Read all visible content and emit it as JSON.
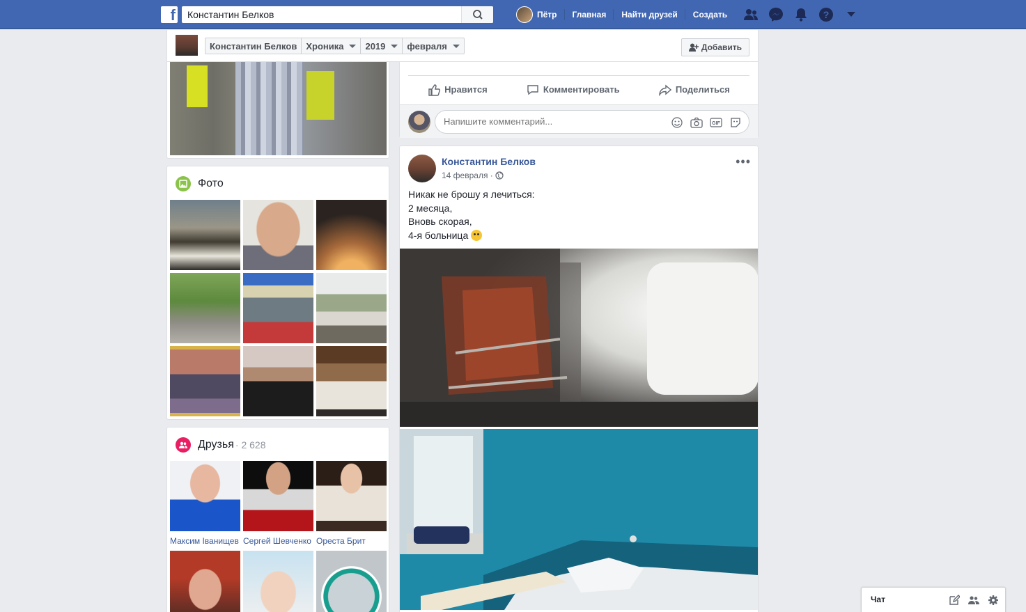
{
  "topbar": {
    "search_value": "Константин Белков",
    "user_name": "Пётр",
    "nav": [
      "Главная",
      "Найти друзей",
      "Создать"
    ]
  },
  "timeline_strip": {
    "crumbs": [
      "Константин Белков",
      "Хроника",
      "2019",
      "февраля"
    ],
    "add_button": "Добавить"
  },
  "photos_card": {
    "title": "Фото"
  },
  "friends_card": {
    "title": "Друзья",
    "count": "· 2 628",
    "friends": [
      {
        "name": "Максим Іванищев"
      },
      {
        "name": "Сергей Шевченко"
      },
      {
        "name": "Ореста Брит"
      }
    ]
  },
  "prev_post": {
    "actions": [
      "Нравится",
      "Комментировать",
      "Поделиться"
    ],
    "comment_placeholder": "Напишите комментарий..."
  },
  "post": {
    "author": "Константин Белков",
    "date": "14 февраля",
    "lines": [
      "Никак не брошу я лечиться:",
      "2 месяца,",
      "Вновь скорая,",
      "4-я больница"
    ]
  },
  "chat": {
    "label": "Чат"
  },
  "colors": {
    "brand": "#4267b2",
    "link": "#385898",
    "background": "#e9ebee"
  }
}
